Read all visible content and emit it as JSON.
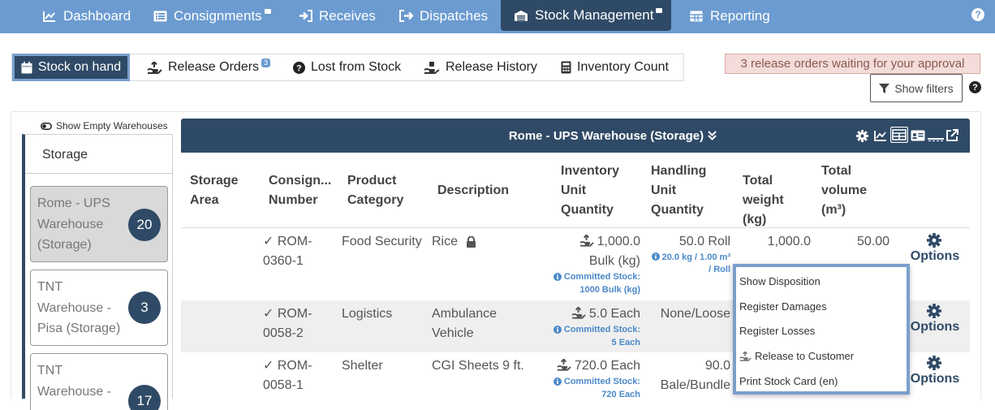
{
  "nav": {
    "items": [
      {
        "label": "Dashboard",
        "icon": "chart-line-icon"
      },
      {
        "label": "Consignments",
        "icon": "list-icon"
      },
      {
        "label": "Receives",
        "icon": "sign-in-icon"
      },
      {
        "label": "Dispatches",
        "icon": "sign-out-icon"
      },
      {
        "label": "Stock Management",
        "icon": "warehouse-icon",
        "active": true
      },
      {
        "label": "Reporting",
        "icon": "table-icon"
      }
    ],
    "help": "?"
  },
  "subtabs": {
    "items": [
      {
        "label": "Stock on hand",
        "icon": "calendar-icon",
        "active": true
      },
      {
        "label": "Release Orders",
        "badge": "3",
        "icon": "hand-box-icon"
      },
      {
        "label": "Lost from Stock",
        "icon": "question-circle-icon"
      },
      {
        "label": "Release History",
        "icon": "hand-holding-icon"
      },
      {
        "label": "Inventory Count",
        "icon": "calculator-icon"
      }
    ]
  },
  "approval_banner": "3 release orders waiting for your approval",
  "filters": {
    "label": "Show filters",
    "help": "?"
  },
  "sidebar": {
    "show_empty_label": "Show Empty Warehouses",
    "header": "Storage",
    "warehouses": [
      {
        "name": "Rome - UPS Warehouse (Storage)",
        "count": "20",
        "selected": true
      },
      {
        "name": "TNT Warehouse - Pisa (Storage)",
        "count": "3"
      },
      {
        "name": "TNT Warehouse - ",
        "count": "17"
      }
    ]
  },
  "table": {
    "title": "Rome - UPS Warehouse (Storage)",
    "headers": {
      "storage_area": "Storage Area",
      "consignment": "Consign... Number",
      "category": "Product Category",
      "description": "Description",
      "inventory": "Inventory Unit Quantity",
      "handling": "Handling Unit Quantity",
      "weight": "Total weight (kg)",
      "volume": "Total volume (m³)"
    },
    "rows": [
      {
        "consignment": "ROM-0360-1",
        "category": "Food Security",
        "description": "Rice",
        "inv_qty": "1,000.0",
        "inv_unit": "Bulk (kg)",
        "committed_label": "Committed Stock:",
        "committed_value": "1000 Bulk (kg)",
        "handling": "50.0 Roll",
        "handling_sub1": "20.0 kg / 1.00 m³",
        "handling_sub2": "/ Roll",
        "weight": "1,000.0",
        "volume": "50.00",
        "options": "Options"
      },
      {
        "consignment": "ROM-0058-2",
        "category": "Logistics",
        "description": "Ambulance Vehicle",
        "inv_qty": "5.0 Each",
        "committed_label": "Committed Stock:",
        "committed_value": "5 Each",
        "handling": "None/Loose",
        "options": "Options"
      },
      {
        "consignment": "ROM-0058-1",
        "category": "Shelter",
        "description": "CGI Sheets 9 ft.",
        "inv_qty": "720.0 Each",
        "committed_label": "Committed Stock:",
        "committed_value": "720 Each",
        "handling": "90.0",
        "handling_unit": "Bale/Bundle",
        "options": "Options"
      }
    ]
  },
  "options_menu": [
    {
      "label": "Show Disposition"
    },
    {
      "label": "Register Damages"
    },
    {
      "label": "Register Losses"
    },
    {
      "label": "Release to Customer",
      "icon": "hand-box-icon"
    },
    {
      "label": "Print Stock Card (en)"
    }
  ],
  "colors": {
    "nav_bg": "#6b9bd0",
    "dark": "#2f4a66",
    "accent_blue": "#4a89c8",
    "banner_bg": "#f3dcd9"
  }
}
